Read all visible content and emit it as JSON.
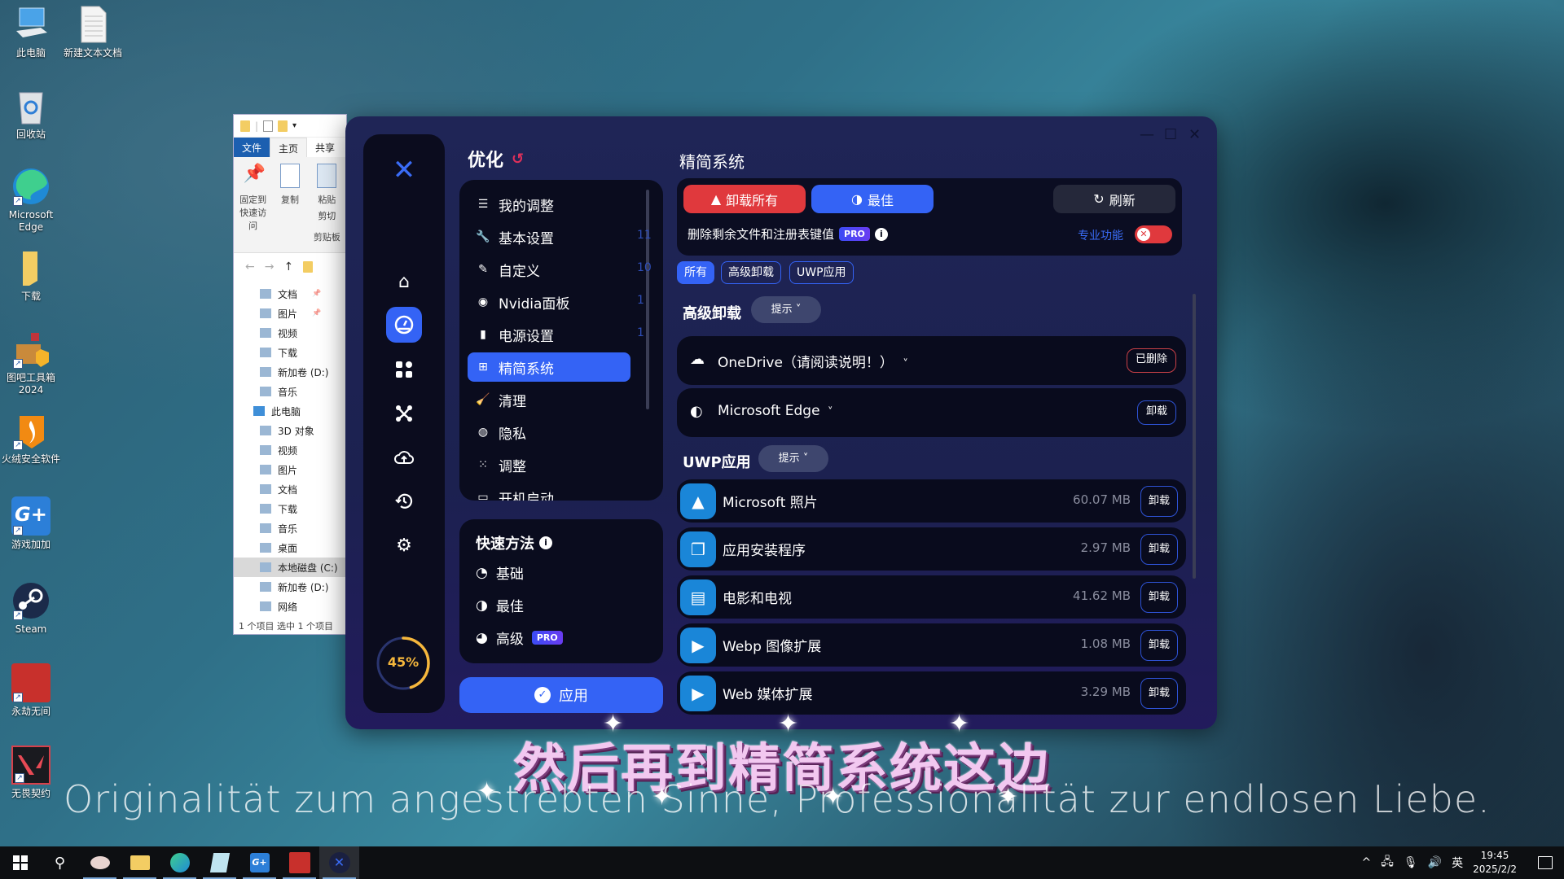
{
  "desktop": {
    "icons": [
      {
        "label": "此电脑",
        "icon": "computer-icon"
      },
      {
        "label": "新建文本文档",
        "icon": "text-document-icon"
      },
      {
        "label": "回收站",
        "icon": "recycle-bin-icon"
      },
      {
        "label": "Microsoft Edge",
        "icon": "edge-icon"
      },
      {
        "label": "下载",
        "icon": "folder-icon"
      },
      {
        "label": "图吧工具箱 2024",
        "icon": "toolbox-icon"
      },
      {
        "label": "火绒安全软件",
        "icon": "huorong-icon"
      },
      {
        "label": "游戏加加",
        "icon": "gplus-icon"
      },
      {
        "label": "Steam",
        "icon": "steam-icon"
      },
      {
        "label": "永劫无间",
        "icon": "naraka-icon"
      },
      {
        "label": "无畏契约",
        "icon": "valorant-icon"
      }
    ]
  },
  "explorer": {
    "tabs": [
      "文件",
      "主页",
      "共享"
    ],
    "ribbon": [
      "固定到快速访问",
      "复制",
      "粘贴",
      "剪切",
      "剪贴板"
    ],
    "tree": [
      {
        "label": "文档",
        "pinned": true
      },
      {
        "label": "图片",
        "pinned": true
      },
      {
        "label": "视频"
      },
      {
        "label": "下载"
      },
      {
        "label": "新加卷 (D:)"
      },
      {
        "label": "音乐"
      },
      {
        "label": "此电脑",
        "top": true
      },
      {
        "label": "3D 对象"
      },
      {
        "label": "视频"
      },
      {
        "label": "图片"
      },
      {
        "label": "文档"
      },
      {
        "label": "下载"
      },
      {
        "label": "音乐"
      },
      {
        "label": "桌面"
      },
      {
        "label": "本地磁盘 (C:)",
        "selected": true
      },
      {
        "label": "新加卷 (D:)"
      },
      {
        "label": "网络"
      }
    ],
    "status": "1 个项目    选中 1 个项目"
  },
  "app": {
    "section_title": "优化",
    "gauge_percent": 45,
    "gauge_label": "45%",
    "menu": [
      {
        "label": "我的调整",
        "icon": "list-add-icon",
        "count": ""
      },
      {
        "label": "基本设置",
        "icon": "wrench-gear-icon",
        "count": "11"
      },
      {
        "label": "自定义",
        "icon": "brush-icon",
        "count": "10"
      },
      {
        "label": "Nvidia面板",
        "icon": "nvidia-icon",
        "count": "1"
      },
      {
        "label": "电源设置",
        "icon": "battery-icon",
        "count": "1"
      },
      {
        "label": "精简系统",
        "icon": "windows-icon",
        "count": "",
        "active": true
      },
      {
        "label": "清理",
        "icon": "cleaner-icon",
        "count": ""
      },
      {
        "label": "隐私",
        "icon": "privacy-icon",
        "count": ""
      },
      {
        "label": "调整",
        "icon": "grid-icon",
        "count": ""
      },
      {
        "label": "开机启动",
        "icon": "startup-icon",
        "count": ""
      }
    ],
    "quick": {
      "title": "快速方法",
      "items": [
        {
          "label": "基础",
          "icon": "gauge-low-icon"
        },
        {
          "label": "最佳",
          "icon": "gauge-mid-icon"
        },
        {
          "label": "高级",
          "icon": "gauge-high-icon",
          "badge": "PRO"
        }
      ]
    },
    "apply_label": "应用",
    "main": {
      "title": "精简系统",
      "uninstall_all": "卸载所有",
      "best": "最佳",
      "refresh": "刷新",
      "residue_label": "删除剩余文件和注册表键值",
      "pro_badge": "PRO",
      "pro_link": "专业功能",
      "pro_toggle_on": false,
      "filters": [
        {
          "label": "所有",
          "active": true
        },
        {
          "label": "高级卸载"
        },
        {
          "label": "UWP应用"
        }
      ],
      "advanced": {
        "title": "高级卸载",
        "hint": "提示",
        "items": [
          {
            "name": "OneDrive（请阅读说明！）",
            "icon": "onedrive-icon",
            "action": "已删除",
            "status": "removed"
          },
          {
            "name": "Microsoft Edge",
            "icon": "edge-icon",
            "action": "卸载",
            "status": "installed"
          }
        ]
      },
      "uwp": {
        "title": "UWP应用",
        "hint": "提示",
        "items": [
          {
            "name": "Microsoft 照片",
            "size": "60.07 MB",
            "action": "卸载",
            "icon": "photos-icon"
          },
          {
            "name": "应用安装程序",
            "size": "2.97 MB",
            "action": "卸载",
            "icon": "app-installer-icon"
          },
          {
            "name": "电影和电视",
            "size": "41.62 MB",
            "action": "卸载",
            "icon": "movies-icon"
          },
          {
            "name": "Webp 图像扩展",
            "size": "1.08 MB",
            "action": "卸载",
            "icon": "extension-icon"
          },
          {
            "name": "Web 媒体扩展",
            "size": "3.29 MB",
            "action": "卸载",
            "icon": "extension-icon"
          }
        ]
      }
    }
  },
  "subtitles": {
    "chinese": "然后再到精简系统这边",
    "german": "Originalität zum angestrebten Sinne, Professionalität zur endlosen Liebe."
  },
  "taskbar": {
    "apps": [
      "start",
      "search",
      "snipping-tool",
      "file-explorer",
      "edge",
      "notepad",
      "gplus",
      "naraka",
      "optimizer"
    ],
    "tray": {
      "ime": "英",
      "time": "19:45",
      "date": "2025/2/2"
    }
  },
  "colors": {
    "accent": "#3463f5",
    "danger": "#e0393d",
    "gauge": "#f6b73c",
    "app_bg": "#1f2556",
    "panel_bg": "#0a0c1e"
  }
}
